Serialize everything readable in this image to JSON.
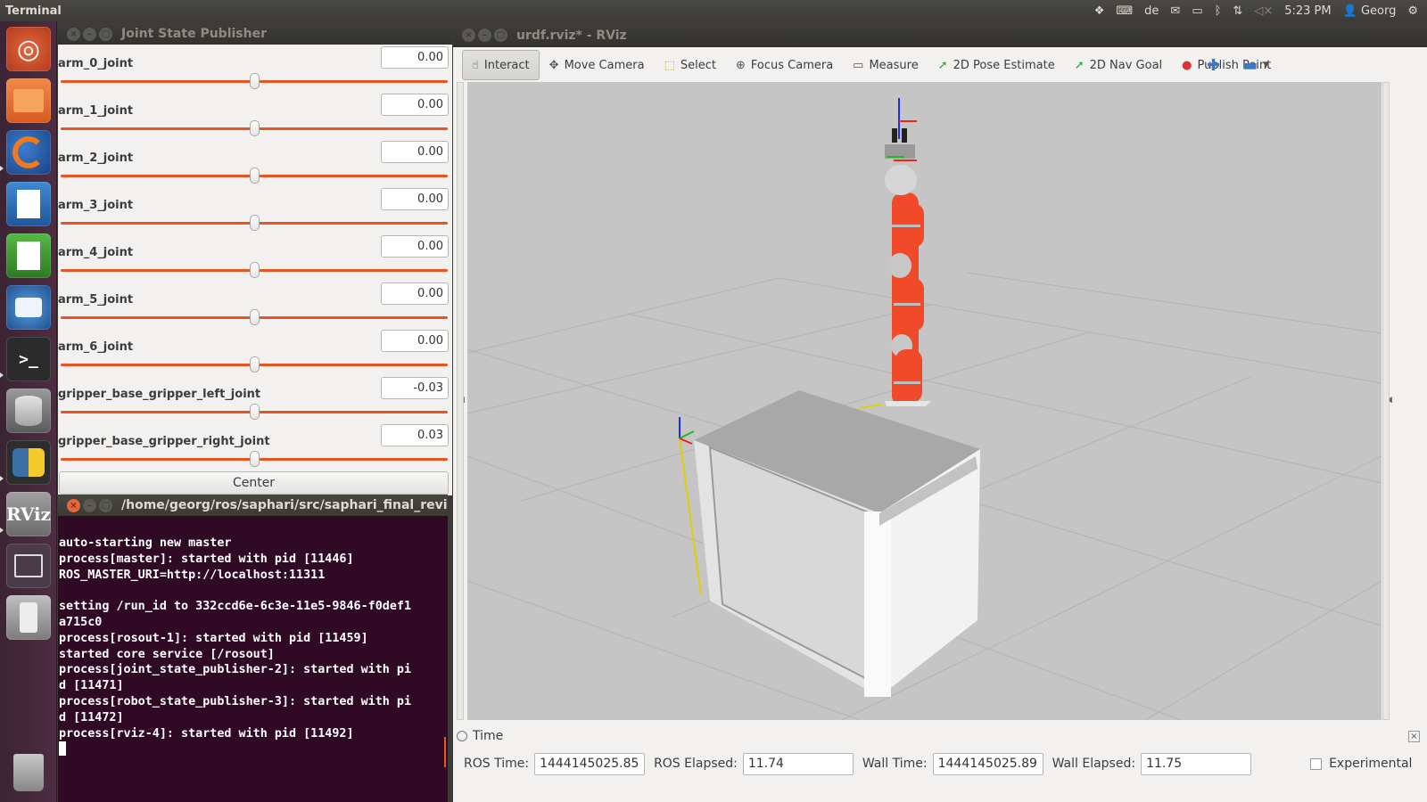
{
  "top_panel": {
    "app_title": "Terminal",
    "keyboard_layout": "de",
    "clock": "5:23 PM",
    "user": "Georg",
    "icons": [
      "dropbox-icon",
      "keyboard-icon",
      "mail-icon",
      "battery-icon",
      "bluetooth-icon",
      "network-icon",
      "volume-muted-icon",
      "user-icon",
      "settings-gear-icon"
    ]
  },
  "launcher": {
    "items": [
      {
        "name": "ubuntu-dash-icon",
        "color": "#c94a2a"
      },
      {
        "name": "files-icon",
        "color": "#e86e2a"
      },
      {
        "name": "firefox-icon",
        "color": "#e06a1f"
      },
      {
        "name": "libreoffice-writer-icon",
        "color": "#2a6fb0"
      },
      {
        "name": "libreoffice-calc-icon",
        "color": "#3b9a34"
      },
      {
        "name": "thunderbird-icon",
        "color": "#2f6fae"
      },
      {
        "name": "terminal-icon",
        "color": "#2c2c2c"
      },
      {
        "name": "database-icon",
        "color": "#7b7b7b"
      },
      {
        "name": "python-icon",
        "color": "#3a6ea5"
      },
      {
        "name": "rviz-icon",
        "color": "#8a8a8a",
        "label": "RViz"
      },
      {
        "name": "workspace-switcher-icon",
        "color": "#6a5a66"
      },
      {
        "name": "usb-drive-icon",
        "color": "#9a9a9a"
      },
      {
        "name": "trash-icon",
        "color": "#8d8d8d"
      }
    ]
  },
  "jsp": {
    "title": "Joint State Publisher",
    "joints": [
      {
        "label": "arm_0_joint",
        "value": "0.00",
        "position": 0.5
      },
      {
        "label": "arm_1_joint",
        "value": "0.00",
        "position": 0.5
      },
      {
        "label": "arm_2_joint",
        "value": "0.00",
        "position": 0.5
      },
      {
        "label": "arm_3_joint",
        "value": "0.00",
        "position": 0.5
      },
      {
        "label": "arm_4_joint",
        "value": "0.00",
        "position": 0.5
      },
      {
        "label": "arm_5_joint",
        "value": "0.00",
        "position": 0.5
      },
      {
        "label": "arm_6_joint",
        "value": "0.00",
        "position": 0.5
      },
      {
        "label": "gripper_base_gripper_left_joint",
        "value": "-0.03",
        "position": 0.5
      },
      {
        "label": "gripper_base_gripper_right_joint",
        "value": "0.03",
        "position": 0.5
      }
    ],
    "center_label": "Center",
    "accent": "#e95420"
  },
  "terminal": {
    "title": "/home/georg/ros/saphari/src/saphari_final_revie",
    "lines": [
      "auto-starting new master",
      "process[master]: started with pid [11446]",
      "ROS_MASTER_URI=http://localhost:11311",
      "",
      "setting /run_id to 332ccd6e-6c3e-11e5-9846-f0def1",
      "a715c0",
      "process[rosout-1]: started with pid [11459]",
      "started core service [/rosout]",
      "process[joint_state_publisher-2]: started with pi",
      "d [11471]",
      "process[robot_state_publisher-3]: started with pi",
      "d [11472]",
      "process[rviz-4]: started with pid [11492]"
    ]
  },
  "rviz": {
    "title": "urdf.rviz* - RViz",
    "tools": [
      {
        "label": "Interact",
        "icon": "hand-pointer-icon",
        "active": true
      },
      {
        "label": "Move Camera",
        "icon": "move-camera-icon",
        "active": false
      },
      {
        "label": "Select",
        "icon": "select-box-icon",
        "active": false
      },
      {
        "label": "Focus Camera",
        "icon": "focus-camera-icon",
        "active": false
      },
      {
        "label": "Measure",
        "icon": "ruler-icon",
        "active": false
      },
      {
        "label": "2D Pose Estimate",
        "icon": "pose-estimate-arrow-icon",
        "active": false
      },
      {
        "label": "2D Nav Goal",
        "icon": "nav-goal-arrow-icon",
        "active": false
      },
      {
        "label": "Publish Point",
        "icon": "map-pin-icon",
        "active": false
      }
    ],
    "time": {
      "panel_title": "Time",
      "ros_time_label": "ROS Time:",
      "ros_time": "1444145025.85",
      "ros_elapsed_label": "ROS Elapsed:",
      "ros_elapsed": "11.74",
      "wall_time_label": "Wall Time:",
      "wall_time": "1444145025.89",
      "wall_elapsed_label": "Wall Elapsed:",
      "wall_elapsed": "11.75",
      "experimental_label": "Experimental",
      "experimental_checked": false
    },
    "robot_color": "#f04a2a"
  }
}
